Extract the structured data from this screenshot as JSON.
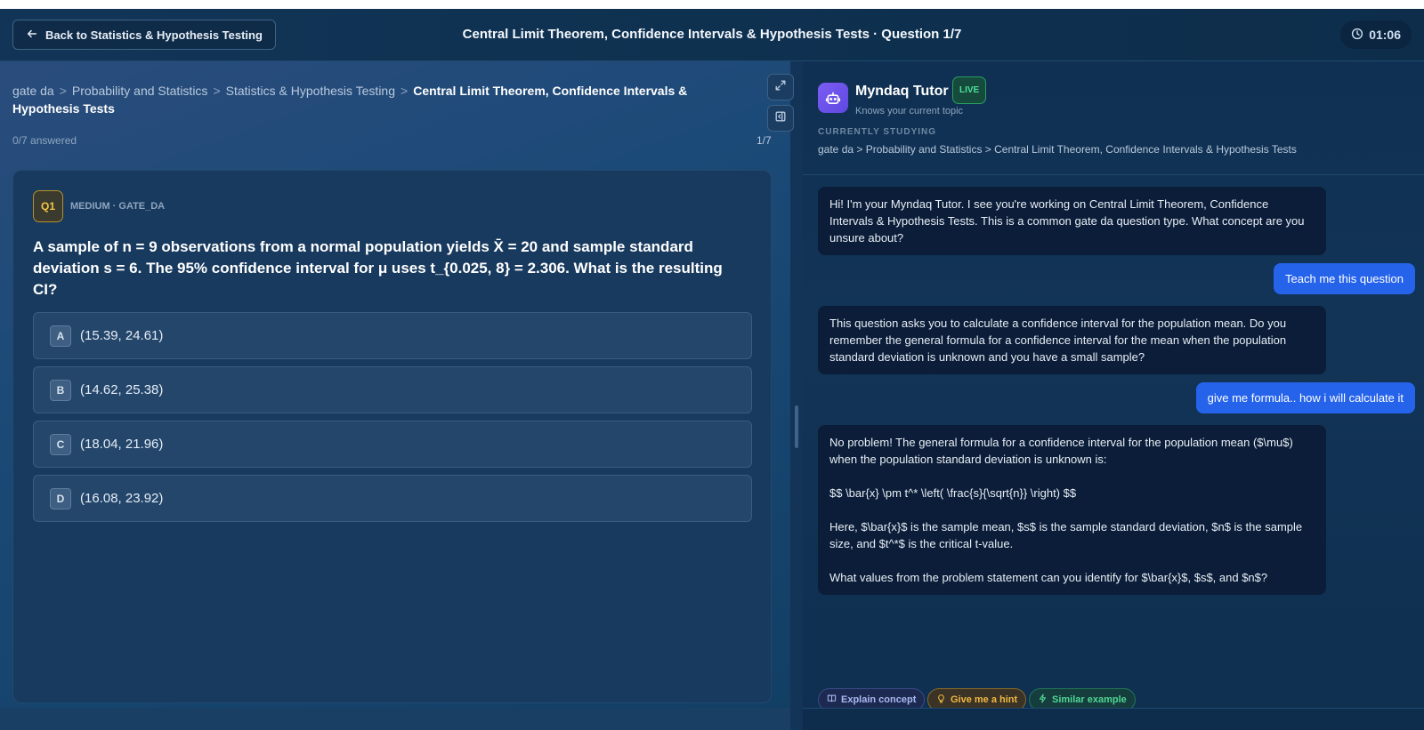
{
  "header": {
    "back_label": "Back to Statistics & Hypothesis Testing",
    "title": "Central Limit Theorem, Confidence Intervals & Hypothesis Tests · Question 1/7",
    "timer": "01:06"
  },
  "breadcrumb": {
    "items": [
      "gate da",
      "Probability and Statistics",
      "Statistics & Hypothesis Testing"
    ],
    "separator": ">",
    "current": "Central Limit Theorem, Confidence Intervals & Hypothesis Tests"
  },
  "progress": {
    "answered": "0/7 answered",
    "counter": "1/7"
  },
  "question": {
    "badge": "Q1",
    "meta": "MEDIUM · GATE_DA",
    "text": "A sample of n = 9 observations from a normal population yields X̄ = 20 and sample standard deviation s = 6. The 95% confidence interval for μ uses t_{0.025, 8} = 2.306. What is the resulting CI?",
    "options": [
      {
        "letter": "A",
        "text": "(15.39, 24.61)"
      },
      {
        "letter": "B",
        "text": "(14.62, 25.38)"
      },
      {
        "letter": "C",
        "text": "(18.04, 21.96)"
      },
      {
        "letter": "D",
        "text": "(16.08, 23.92)"
      }
    ]
  },
  "tutor": {
    "name": "Myndaq Tutor",
    "live": "LIVE",
    "subtitle": "Knows your current topic",
    "currently_label": "CURRENTLY STUDYING",
    "currently_path": "gate da > Probability and Statistics > Central Limit Theorem, Confidence Intervals & Hypothesis Tests"
  },
  "messages": [
    {
      "role": "bot",
      "paragraphs": [
        "Hi! I'm your Myndaq Tutor. I see you're working on Central Limit Theorem, Confidence Intervals & Hypothesis Tests. This is a common gate da question type. What concept are you unsure about?"
      ]
    },
    {
      "role": "user",
      "text": "Teach me this question"
    },
    {
      "role": "bot",
      "paragraphs": [
        "This question asks you to calculate a confidence interval for the population mean. Do you remember the general formula for a confidence interval for the mean when the population standard deviation is unknown and you have a small sample?"
      ]
    },
    {
      "role": "user",
      "text": "give me formula.. how i will calculate it"
    },
    {
      "role": "bot",
      "paragraphs": [
        "No problem! The general formula for a confidence interval for the population mean ($\\mu$) when the population standard deviation is unknown is:",
        "$$ \\bar{x} \\pm t^* \\left( \\frac{s}{\\sqrt{n}} \\right) $$",
        "Here, $\\bar{x}$ is the sample mean, $s$ is the sample standard deviation, $n$ is the sample size, and $t^*$ is the critical t-value.",
        "What values from the problem statement can you identify for $\\bar{x}$, $s$, and $n$?"
      ]
    }
  ],
  "chips": [
    "Explain concept",
    "Give me a hint",
    "Similar example"
  ],
  "colors": {
    "accent_user": "#2563eb",
    "live_green": "#4ee09a",
    "badge_gold": "#f5c542"
  },
  "icons": [
    "arrow-left-icon",
    "clock-icon",
    "expand-icon",
    "collapse-panel-icon",
    "robot-icon",
    "book-icon",
    "lightbulb-icon",
    "sparkle-icon"
  ]
}
